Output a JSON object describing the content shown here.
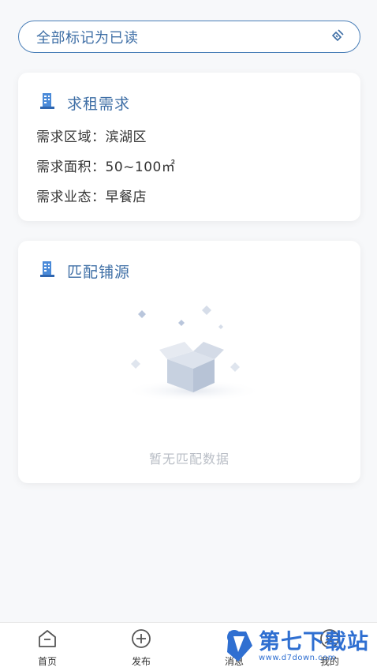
{
  "toolbar": {
    "mark_all_read": "全部标记为已读"
  },
  "demand": {
    "title": "求租需求",
    "area_label": "需求区域：",
    "area_value": "滨湖区",
    "size_label": "需求面积：",
    "size_value": "50~100㎡",
    "format_label": "需求业态：",
    "format_value": "早餐店"
  },
  "match": {
    "title": "匹配铺源",
    "empty_text": "暂无匹配数据"
  },
  "tabbar": {
    "items": [
      {
        "label": "首页",
        "icon": "home-icon"
      },
      {
        "label": "发布",
        "icon": "plus-circle-icon"
      },
      {
        "label": "消息",
        "icon": "message-icon"
      },
      {
        "label": "我的",
        "icon": "user-icon"
      }
    ]
  },
  "watermark": {
    "main": "第七下载站",
    "sub": "www.d7down.com"
  },
  "colors": {
    "accent": "#3f6fa6",
    "border": "#4a7fb8",
    "muted": "#b9bec6"
  }
}
